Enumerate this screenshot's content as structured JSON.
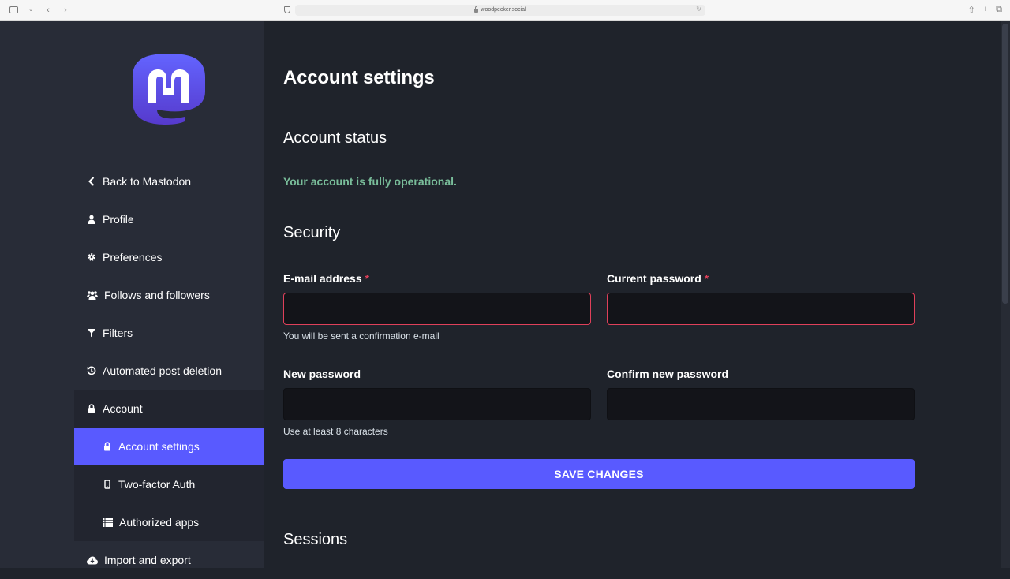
{
  "browser": {
    "url": "woodpecker.social"
  },
  "sidebar": {
    "items": [
      {
        "label": "Back to Mastodon",
        "icon": "chevron-left-icon"
      },
      {
        "label": "Profile",
        "icon": "user-icon"
      },
      {
        "label": "Preferences",
        "icon": "gear-icon"
      },
      {
        "label": "Follows and followers",
        "icon": "users-icon"
      },
      {
        "label": "Filters",
        "icon": "filter-icon"
      },
      {
        "label": "Automated post deletion",
        "icon": "history-icon"
      },
      {
        "label": "Account",
        "icon": "lock-icon"
      }
    ],
    "account_sub": [
      {
        "label": "Account settings",
        "icon": "lock-icon"
      },
      {
        "label": "Two-factor Auth",
        "icon": "mobile-icon"
      },
      {
        "label": "Authorized apps",
        "icon": "list-icon"
      }
    ],
    "after": [
      {
        "label": "Import and export",
        "icon": "cloud-download-icon"
      }
    ]
  },
  "main": {
    "title": "Account settings",
    "account_status": {
      "heading": "Account status",
      "message": "Your account is fully operational."
    },
    "security": {
      "heading": "Security",
      "email_label": "E-mail address",
      "email_hint": "You will be sent a confirmation e-mail",
      "current_password_label": "Current password",
      "new_password_label": "New password",
      "new_password_hint": "Use at least 8 characters",
      "confirm_password_label": "Confirm new password",
      "required_mark": "*",
      "save_label": "SAVE CHANGES"
    },
    "sessions_heading": "Sessions"
  },
  "colors": {
    "accent": "#595aff",
    "success": "#79bd9a",
    "error": "#df405a",
    "sidebar_bg": "#282c37",
    "main_bg": "#1f232b"
  }
}
